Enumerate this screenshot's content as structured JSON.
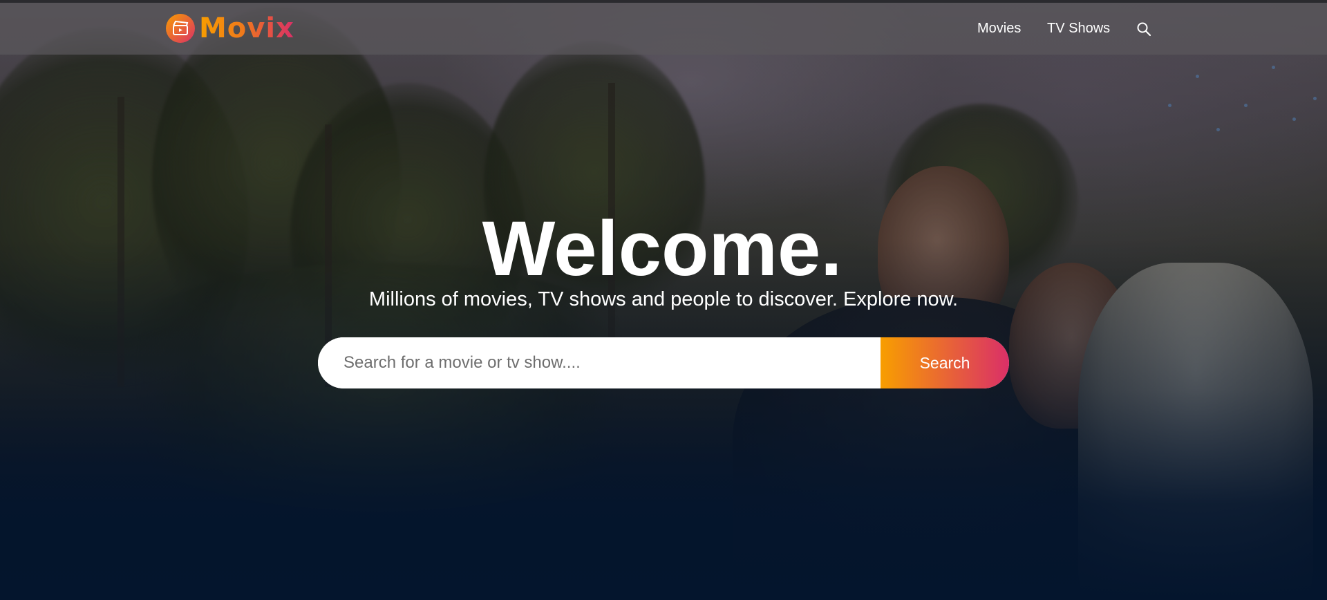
{
  "header": {
    "logo_text": "Movix",
    "nav": {
      "movies_label": "Movies",
      "tv_shows_label": "TV Shows"
    },
    "search_icon": "search-icon"
  },
  "hero": {
    "title": "Welcome.",
    "subtitle": "Millions of movies, TV shows and people to discover. Explore now.",
    "search": {
      "placeholder": "Search for a movie or tv show....",
      "button_label": "Search"
    }
  },
  "colors": {
    "brand_gradient_start": "#f89e00",
    "brand_gradient_end": "#da2f68",
    "page_background": "#04152d"
  }
}
